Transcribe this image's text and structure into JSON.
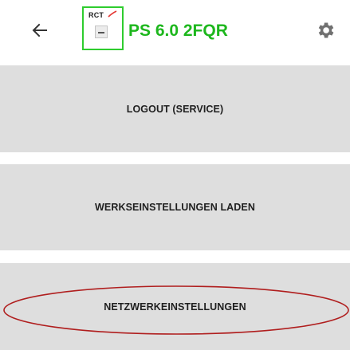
{
  "header": {
    "back_icon": "arrow-left-icon",
    "logo": {
      "text": "RCT",
      "accent_color": "#e53935",
      "border_color": "#2ecc2e"
    },
    "title": "PS 6.0 2FQR",
    "title_color": "#1db71d",
    "settings_icon": "gear-icon"
  },
  "menu": {
    "items": [
      {
        "label": "LOGOUT (SERVICE)"
      },
      {
        "label": "WERKSEINSTELLUNGEN LADEN"
      },
      {
        "label": "NETZWERKEINSTELLUNGEN"
      }
    ],
    "button_color": "#dedede"
  },
  "annotation": {
    "highlight_color": "#b01e1e",
    "highlighted_item": "NETZWERKEINSTELLUNGEN"
  }
}
